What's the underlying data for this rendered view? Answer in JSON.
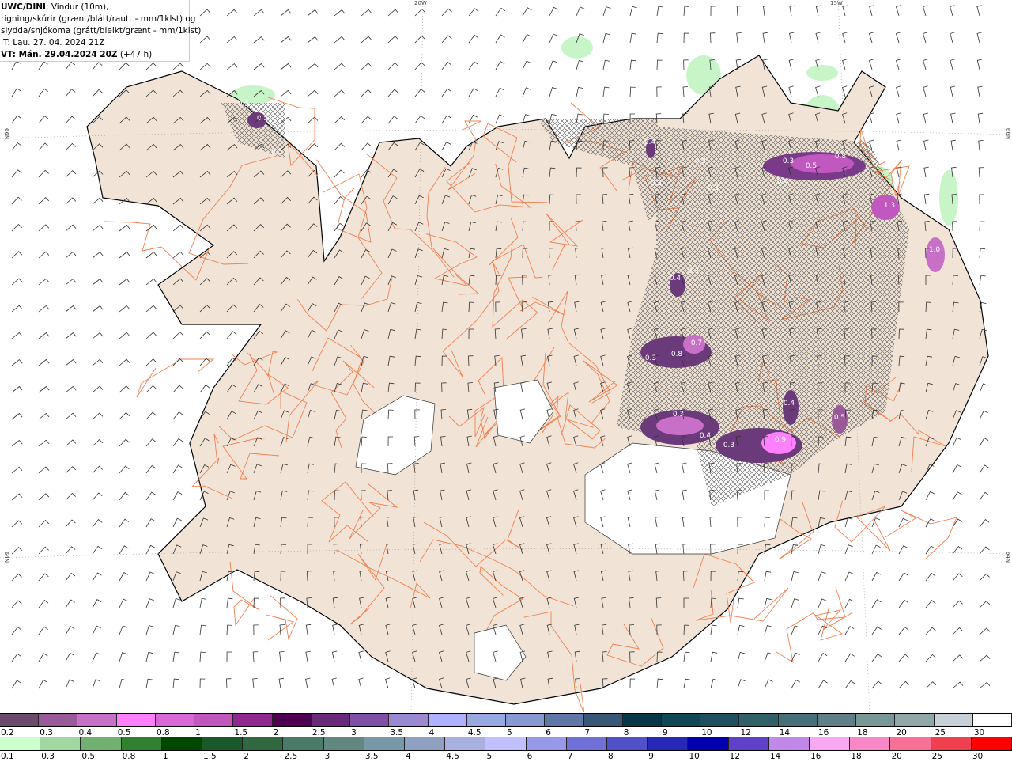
{
  "title": {
    "model": "UWC/DINI",
    "line1_rest": ": Vindur (10m),",
    "line2": "rigning/skúrir (grænt/blátt/rautt - mm/1klst) og",
    "line3": "slydda/snjókoma (grátt/bleikt/grænt - mm/1klst)",
    "it": "IT: Lau. 27. 04. 2024 21Z",
    "vt_bold": "VT: Mán. 29.04.2024 20Z",
    "vt_rest": " (+47 h)"
  },
  "axes": {
    "lon1": "20W",
    "lon2": "15W",
    "lat_left_top": "66N",
    "lat_left_bottom": "64N",
    "lat_right_top": "66N",
    "lat_right_bottom": "64N"
  },
  "colors": {
    "land": "#f1e4d6",
    "roads": "#f08050",
    "glacier": "#ffffff",
    "sea": "#ffffff",
    "hatch": "#555555",
    "green_precip": "#c8f5c8"
  },
  "contour_labels": [
    "0.5",
    "0.5",
    "0.5",
    "0.4",
    "0.3",
    "0.3",
    "0.3",
    "0.3",
    "0.4",
    "0.5",
    "0.8",
    "1.3",
    "1.0",
    "0.4",
    "0.3",
    "0.3",
    "0.4",
    "0.7",
    "0.8",
    "0.3",
    "0.4",
    "0.9",
    "0.5",
    "0.3"
  ],
  "legend_snow": {
    "labels": [
      "0.2",
      "0.3",
      "0.4",
      "0.5",
      "0.8",
      "1",
      "1.5",
      "2",
      "2.5",
      "3",
      "3.5",
      "4",
      "4.5",
      "5",
      "6",
      "7",
      "8",
      "9",
      "10",
      "12",
      "14",
      "16",
      "18",
      "20",
      "25",
      "30"
    ],
    "colors": [
      "#6b4a6b",
      "#9a5a9a",
      "#c870c8",
      "#ff80ff",
      "#d868d8",
      "#c058c0",
      "#902890",
      "#500050",
      "#6a2a7a",
      "#8050a8",
      "#9a88d0",
      "#b0b0ff",
      "#98a8e0",
      "#8898d0",
      "#6078a8",
      "#385878",
      "#083848",
      "#104858",
      "#205060",
      "#306068",
      "#487078",
      "#608088",
      "#789898",
      "#90a8a8",
      "#c8d0d8",
      "#ffffff"
    ]
  },
  "legend_rain": {
    "labels": [
      "0.1",
      "0.3",
      "0.5",
      "0.8",
      "1",
      "1.5",
      "2",
      "2.5",
      "3",
      "3.5",
      "4",
      "4.5",
      "5",
      "6",
      "7",
      "8",
      "9",
      "10",
      "12",
      "14",
      "16",
      "18",
      "20",
      "25",
      "30"
    ],
    "colors": [
      "#ccffcc",
      "#a0d8a0",
      "#70b070",
      "#308030",
      "#004800",
      "#1a5a2a",
      "#306840",
      "#4a7a68",
      "#608880",
      "#7898a8",
      "#90a0c0",
      "#a8b0e0",
      "#c0c0ff",
      "#9898e8",
      "#7070d8",
      "#5050c8",
      "#2828b8",
      "#0000b0",
      "#6040c8",
      "#c088e8",
      "#f8a8f0",
      "#f888c8",
      "#f87098",
      "#f04050",
      "#ff0000"
    ]
  }
}
